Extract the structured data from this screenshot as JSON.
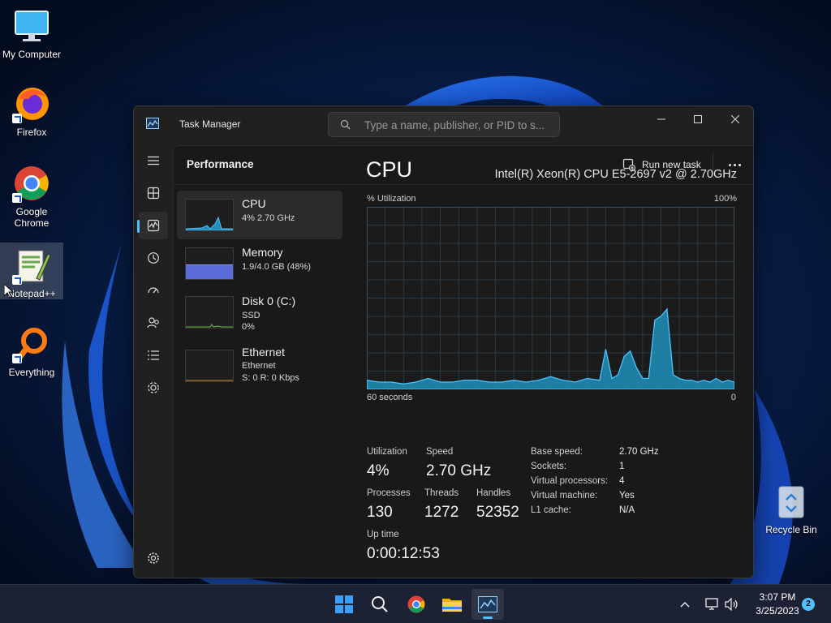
{
  "desktop": {
    "icons": [
      {
        "label": "My Computer",
        "icon": "monitor-icon"
      },
      {
        "label": "Firefox",
        "icon": "firefox-icon"
      },
      {
        "label": "Google Chrome",
        "icon": "chrome-icon"
      },
      {
        "label": "Notepad++",
        "icon": "notepadpp-icon"
      },
      {
        "label": "Everything",
        "icon": "everything-search-icon"
      }
    ],
    "recycle_bin": {
      "label": "Recycle Bin",
      "icon": "recycle-bin-icon"
    }
  },
  "window": {
    "title": "Task Manager",
    "search_placeholder": "Type a name, publisher, or PID to s...",
    "controls": [
      "minimize-icon",
      "maximize-icon",
      "close-icon"
    ]
  },
  "nav": {
    "items": [
      {
        "name": "hamburger-menu-icon"
      },
      {
        "name": "processes-icon"
      },
      {
        "name": "performance-icon",
        "active": true
      },
      {
        "name": "app-history-icon"
      },
      {
        "name": "startup-apps-icon"
      },
      {
        "name": "users-icon"
      },
      {
        "name": "details-icon"
      },
      {
        "name": "services-icon"
      },
      {
        "name": "settings-icon"
      }
    ]
  },
  "header": {
    "page_title": "Performance",
    "run_new_task": "Run new task"
  },
  "resources": [
    {
      "name": "CPU",
      "line1": "4% 2.70 GHz",
      "line2": "",
      "active": true
    },
    {
      "name": "Memory",
      "line1": "1.9/4.0 GB (48%)",
      "line2": "",
      "fill_fraction": 0.48
    },
    {
      "name": "Disk 0 (C:)",
      "line1": "SSD",
      "line2": "0%"
    },
    {
      "name": "Ethernet",
      "line1": "Ethernet",
      "line2": "S: 0 R: 0 Kbps"
    }
  ],
  "detail": {
    "title": "CPU",
    "model": "Intel(R) Xeon(R) CPU E5-2697 v2 @ 2.70GHz",
    "graph_label": "% Utilization",
    "graph_max": "100%",
    "graph_time_left": "60 seconds",
    "graph_time_right": "0",
    "stats": {
      "utilization_label": "Utilization",
      "utilization": "4%",
      "speed_label": "Speed",
      "speed": "2.70 GHz",
      "processes_label": "Processes",
      "processes": "130",
      "threads_label": "Threads",
      "threads": "1272",
      "handles_label": "Handles",
      "handles": "52352",
      "uptime_label": "Up time",
      "uptime": "0:00:12:53"
    },
    "specs": [
      {
        "key": "Base speed:",
        "value": "2.70 GHz"
      },
      {
        "key": "Sockets:",
        "value": "1"
      },
      {
        "key": "Virtual processors:",
        "value": "4"
      },
      {
        "key": "Virtual machine:",
        "value": "Yes"
      },
      {
        "key": "L1 cache:",
        "value": "N/A"
      }
    ]
  },
  "chart_data": {
    "type": "area",
    "title": "",
    "xlabel": "",
    "ylabel": "% Utilization",
    "xlim": [
      60,
      0
    ],
    "ylim": [
      0,
      100
    ],
    "grid": true,
    "color": "#4cc2ff",
    "x": [
      60,
      58,
      56,
      54,
      52,
      50,
      48,
      46,
      44,
      42,
      40,
      38,
      36,
      34,
      32,
      30,
      28,
      26,
      24,
      22,
      21,
      20,
      19,
      18,
      17,
      16,
      15,
      14,
      13,
      12,
      11,
      10,
      9,
      8,
      7,
      6,
      5,
      4,
      3,
      2,
      1,
      0
    ],
    "y": [
      5,
      4,
      4,
      3,
      4,
      6,
      4,
      4,
      5,
      5,
      4,
      4,
      5,
      4,
      5,
      7,
      5,
      4,
      6,
      5,
      22,
      6,
      8,
      18,
      21,
      12,
      6,
      6,
      38,
      40,
      44,
      8,
      6,
      5,
      5,
      4,
      5,
      4,
      6,
      4,
      5,
      4
    ]
  },
  "taskbar": {
    "apps": [
      {
        "name": "start-icon"
      },
      {
        "name": "search-icon"
      },
      {
        "name": "chrome-icon"
      },
      {
        "name": "file-explorer-icon"
      },
      {
        "name": "task-manager-icon",
        "active": true
      }
    ],
    "time": "3:07 PM",
    "date": "3/25/2023",
    "notification_count": "2"
  }
}
